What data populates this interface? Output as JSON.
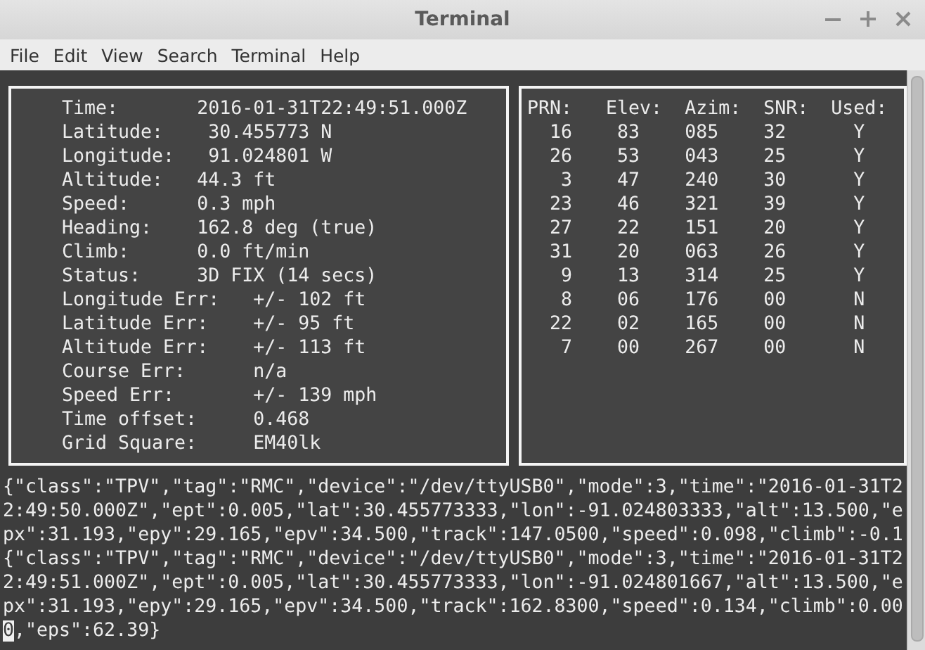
{
  "window": {
    "title": "Terminal"
  },
  "menu": [
    "File",
    "Edit",
    "View",
    "Search",
    "Terminal",
    "Help"
  ],
  "fix_panel": {
    "fields": [
      {
        "label": "Time:",
        "value": "2016-01-31T22:49:51.000Z",
        "kind": "main"
      },
      {
        "label": "Latitude:",
        "value": " 30.455773 N",
        "kind": "main"
      },
      {
        "label": "Longitude:",
        "value": " 91.024801 W",
        "kind": "main"
      },
      {
        "label": "Altitude:",
        "value": "44.3 ft",
        "kind": "main"
      },
      {
        "label": "Speed:",
        "value": "0.3 mph",
        "kind": "main"
      },
      {
        "label": "Heading:",
        "value": "162.8 deg (true)",
        "kind": "main"
      },
      {
        "label": "Climb:",
        "value": "0.0 ft/min",
        "kind": "main"
      },
      {
        "label": "Status:",
        "value": "3D FIX (14 secs)",
        "kind": "main"
      },
      {
        "label": "Longitude Err:",
        "value": "+/- 102 ft",
        "kind": "error"
      },
      {
        "label": "Latitude Err:",
        "value": "+/- 95 ft",
        "kind": "error"
      },
      {
        "label": "Altitude Err:",
        "value": "+/- 113 ft",
        "kind": "error"
      },
      {
        "label": "Course Err:",
        "value": "n/a",
        "kind": "error"
      },
      {
        "label": "Speed Err:",
        "value": "+/- 139 mph",
        "kind": "error"
      },
      {
        "label": "Time offset:",
        "value": "0.468",
        "kind": "error"
      },
      {
        "label": "Grid Square:",
        "value": "EM40lk",
        "kind": "error"
      }
    ]
  },
  "satellite_panel": {
    "columns": [
      "PRN:",
      "Elev:",
      "Azim:",
      "SNR:",
      "Used:"
    ],
    "rows": [
      [
        "16",
        "83",
        "085",
        "32",
        "Y"
      ],
      [
        "26",
        "53",
        "043",
        "25",
        "Y"
      ],
      [
        "3",
        "47",
        "240",
        "30",
        "Y"
      ],
      [
        "23",
        "46",
        "321",
        "39",
        "Y"
      ],
      [
        "27",
        "22",
        "151",
        "20",
        "Y"
      ],
      [
        "31",
        "20",
        "063",
        "26",
        "Y"
      ],
      [
        "9",
        "13",
        "314",
        "25",
        "Y"
      ],
      [
        "8",
        "06",
        "176",
        "00",
        "N"
      ],
      [
        "22",
        "02",
        "165",
        "00",
        "N"
      ],
      [
        "7",
        "00",
        "267",
        "00",
        "N"
      ]
    ]
  },
  "log_lines": [
    {
      "text": "{\"class\":\"TPV\",\"tag\":\"RMC\",\"device\":\"/dev/ttyUSB0\",\"mode\":3,\"time\":\"2016-01-31T2",
      "cursor": false
    },
    {
      "text": "2:49:50.000Z\",\"ept\":0.005,\"lat\":30.455773333,\"lon\":-91.024803333,\"alt\":13.500,\"e",
      "cursor": false
    },
    {
      "text": "px\":31.193,\"epy\":29.165,\"epv\":34.500,\"track\":147.0500,\"speed\":0.098,\"climb\":-0.1",
      "cursor": false
    },
    {
      "text": "{\"class\":\"TPV\",\"tag\":\"RMC\",\"device\":\"/dev/ttyUSB0\",\"mode\":3,\"time\":\"2016-01-31T2",
      "cursor": false
    },
    {
      "text": "2:49:51.000Z\",\"ept\":0.005,\"lat\":30.455773333,\"lon\":-91.024801667,\"alt\":13.500,\"e",
      "cursor": false
    },
    {
      "text": "px\":31.193,\"epy\":29.165,\"epv\":34.500,\"track\":162.8300,\"speed\":0.134,\"climb\":0.00",
      "cursor": false
    },
    {
      "text": "0,\"eps\":62.39}",
      "cursor": true
    }
  ]
}
